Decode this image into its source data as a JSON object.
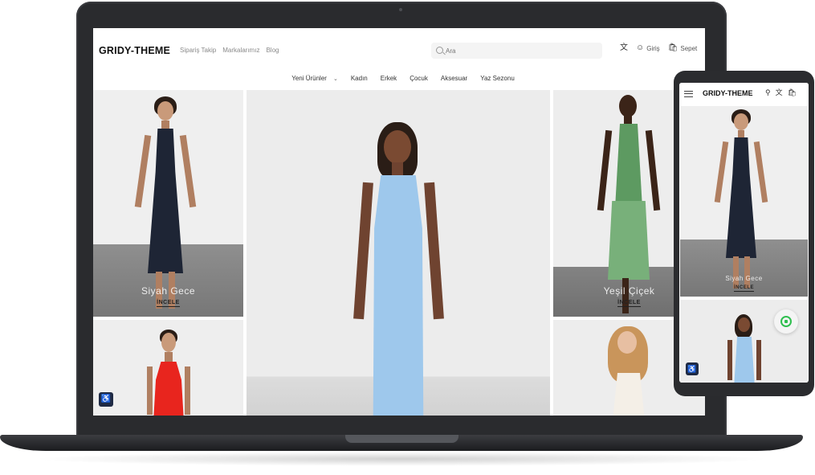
{
  "desktop": {
    "logo": "GRIDY-THEME",
    "top_links": [
      "Sipariş Takip",
      "Markalarımız",
      "Blog"
    ],
    "search": {
      "placeholder": "Ara"
    },
    "actions": {
      "login": "Giriş",
      "cart": "Sepet"
    },
    "nav": [
      "Yeni Ürünler",
      "Kadın",
      "Erkek",
      "Çocuk",
      "Aksesuar",
      "Yaz Sezonu"
    ],
    "tiles": [
      {
        "label": "Siyah Gece",
        "cta": "İNCELE"
      },
      {
        "label": "Yeşil Çiçek",
        "cta": "İNCELE"
      }
    ]
  },
  "mobile": {
    "logo": "GRIDY-THEME",
    "tile": {
      "label": "Siyah Gece",
      "cta": "İNCELE"
    }
  },
  "colors": {
    "accent": "#1f2a44",
    "whatsapp": "#2fbf4f",
    "device": "#2a2b2e"
  },
  "icons": {
    "translate": "translate-icon",
    "user": "user-icon",
    "cart": "cart-icon",
    "search": "search-icon",
    "accessibility": "accessibility-icon",
    "whatsapp": "whatsapp-icon",
    "menu": "hamburger-icon"
  }
}
